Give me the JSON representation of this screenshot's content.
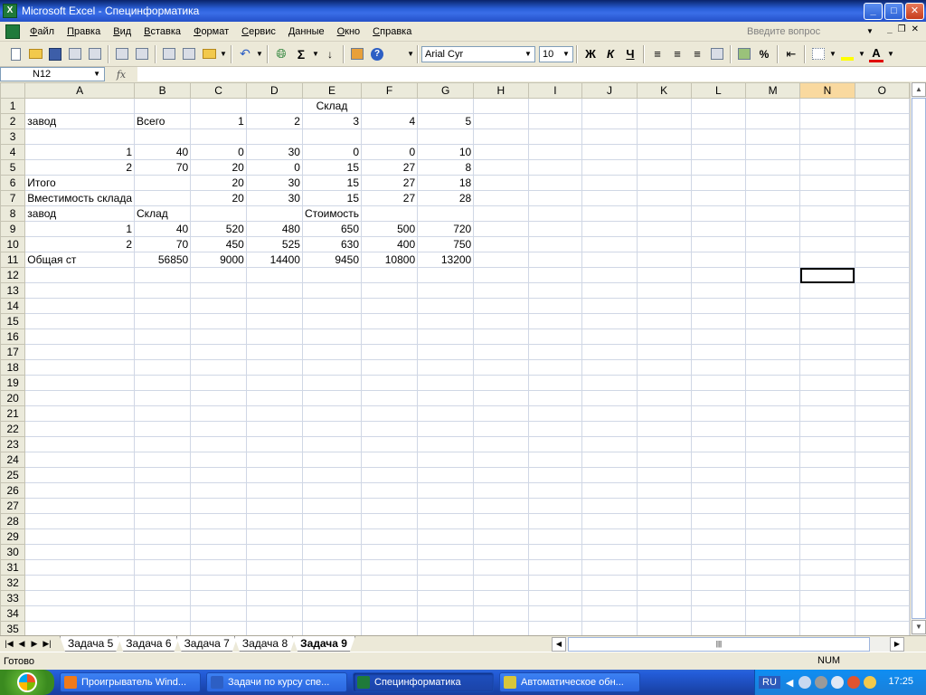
{
  "window": {
    "title": "Microsoft Excel - Специнформатика",
    "icon_label": "X",
    "buttons": {
      "minimize": "_",
      "maximize": "□",
      "close": "✕"
    }
  },
  "menu": {
    "items": [
      "Файл",
      "Правка",
      "Вид",
      "Вставка",
      "Формат",
      "Сервис",
      "Данные",
      "Окно",
      "Справка"
    ],
    "help_placeholder": "Введите вопрос"
  },
  "toolbar": {
    "font_name": "Arial Cyr",
    "font_size": "10",
    "bold_label": "Ж",
    "italic_label": "К",
    "underline_label": "Ч",
    "sum_label": "Σ",
    "percent_label": "%",
    "fontcolor_label": "A"
  },
  "formula_bar": {
    "name_box": "N12",
    "fx_label": "fx",
    "formula": ""
  },
  "grid": {
    "columns": [
      "A",
      "B",
      "C",
      "D",
      "E",
      "F",
      "G",
      "H",
      "I",
      "J",
      "K",
      "L",
      "M",
      "N",
      "O"
    ],
    "selected_column": "N",
    "active_cell": "N12",
    "rows": [
      {
        "n": "1",
        "cells": [
          "",
          "",
          "",
          "",
          "Склад",
          "",
          ""
        ]
      },
      {
        "n": "2",
        "cells": [
          "завод",
          "Всего",
          "1",
          "2",
          "3",
          "4",
          "5"
        ]
      },
      {
        "n": "3",
        "cells": [
          "",
          "",
          "",
          "",
          "",
          "",
          ""
        ]
      },
      {
        "n": "4",
        "cells": [
          "1",
          "40",
          "0",
          "30",
          "0",
          "0",
          "10"
        ]
      },
      {
        "n": "5",
        "cells": [
          "2",
          "70",
          "20",
          "0",
          "15",
          "27",
          "8"
        ]
      },
      {
        "n": "6",
        "cells": [
          "Итого",
          "",
          "20",
          "30",
          "15",
          "27",
          "18"
        ]
      },
      {
        "n": "7",
        "cells": [
          "Вместимость склада",
          "",
          "20",
          "30",
          "15",
          "27",
          "28"
        ]
      },
      {
        "n": "8",
        "cells": [
          "завод",
          "Склад",
          "",
          "",
          "Стоимость",
          "",
          ""
        ]
      },
      {
        "n": "9",
        "cells": [
          "1",
          "40",
          "520",
          "480",
          "650",
          "500",
          "720"
        ]
      },
      {
        "n": "10",
        "cells": [
          "2",
          "70",
          "450",
          "525",
          "630",
          "400",
          "750"
        ]
      },
      {
        "n": "11",
        "cells": [
          "Общая ст",
          "56850",
          "9000",
          "14400",
          "9450",
          "10800",
          "13200"
        ]
      }
    ],
    "empty_rows": [
      "12",
      "13",
      "14",
      "15",
      "16",
      "17",
      "18",
      "19",
      "20",
      "21",
      "22",
      "23",
      "24",
      "25",
      "26",
      "27",
      "28",
      "29",
      "30",
      "31",
      "32",
      "33",
      "34",
      "35"
    ]
  },
  "sheet_tabs": {
    "tabs": [
      "Задача 5",
      "Задача 6",
      "Задача 7",
      "Задача 8",
      "Задача 9"
    ],
    "active": "Задача 9"
  },
  "status_bar": {
    "status": "Готово",
    "num_indicator": "NUM"
  },
  "taskbar": {
    "buttons": [
      {
        "label": "Проигрыватель Wind...",
        "icon_color": "#f07a1a"
      },
      {
        "label": "Задачи по курсу спе...",
        "icon_color": "#2d5fc4"
      },
      {
        "label": "Специнформатика",
        "icon_color": "#1f7a3a"
      },
      {
        "label": "Автоматическое обн...",
        "icon_color": "#d8c63a"
      }
    ],
    "active_index": 2,
    "language": "RU",
    "clock": "17:25"
  }
}
